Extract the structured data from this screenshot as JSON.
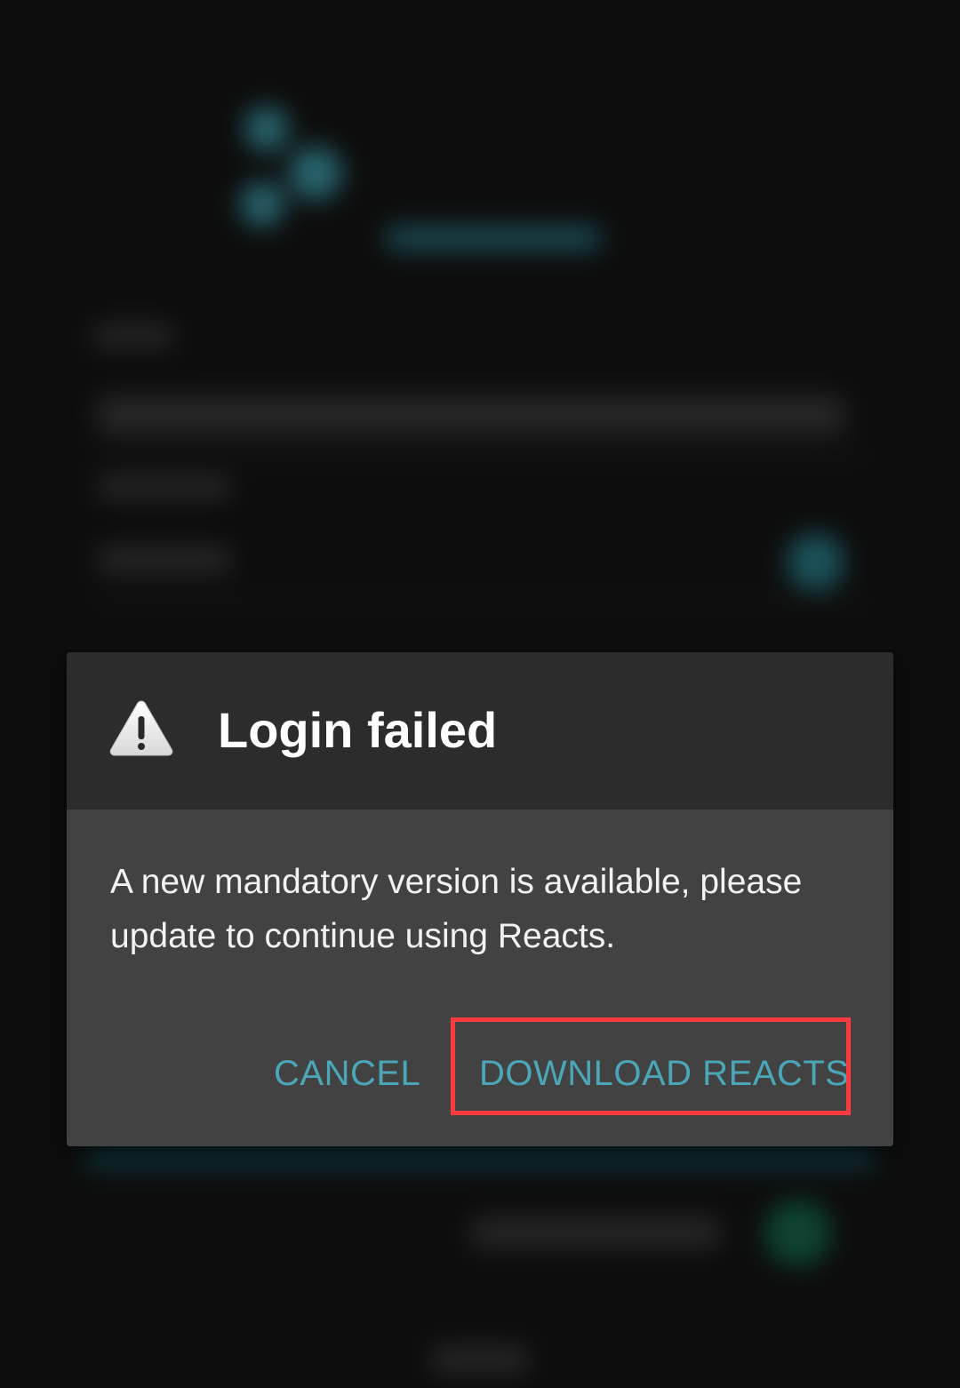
{
  "dialog": {
    "icon": "warning-triangle-icon",
    "title": "Login failed",
    "message": "A new mandatory version is available, please update to continue using Reacts.",
    "cancel_label": "CANCEL",
    "download_label": "DOWNLOAD REACTS"
  },
  "colors": {
    "button_text": "#4ba7b8",
    "dialog_header": "#2c2c2c",
    "dialog_body": "#424242",
    "highlight": "#ff3b3f"
  }
}
